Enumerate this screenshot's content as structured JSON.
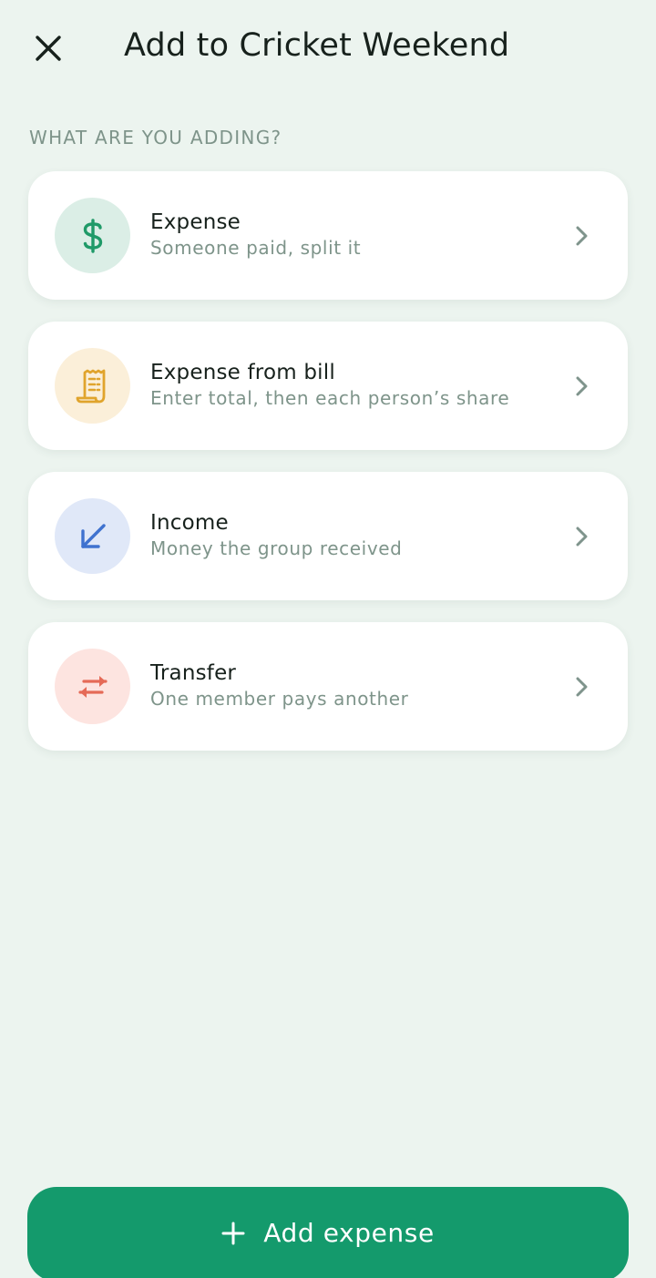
{
  "header": {
    "close_icon": "close-icon",
    "title": "Add to Cricket Weekend"
  },
  "section_label": "WHAT ARE YOU ADDING?",
  "options": [
    {
      "title": "Expense",
      "subtitle": "Someone paid, split it",
      "icon": "dollar-icon",
      "icon_color": "#1f9a68",
      "icon_bg": "#dbeee6"
    },
    {
      "title": "Expense from bill",
      "subtitle": "Enter total, then each person’s share",
      "icon": "receipt-icon",
      "icon_color": "#e0a42c",
      "icon_bg": "#fbefd9"
    },
    {
      "title": "Income",
      "subtitle": "Money the group received",
      "icon": "arrow-down-left-icon",
      "icon_color": "#3f72cf",
      "icon_bg": "#e0e8f8"
    },
    {
      "title": "Transfer",
      "subtitle": "One member pays another",
      "icon": "transfer-arrows-icon",
      "icon_color": "#e56a57",
      "icon_bg": "#fde4e0"
    }
  ],
  "primary_button": {
    "icon": "plus-icon",
    "label": "Add expense",
    "color": "#149a6c"
  },
  "colors": {
    "background": "#ecf4ef",
    "card": "#ffffff",
    "muted_text": "#7e948a",
    "chevron": "#7f948c"
  }
}
